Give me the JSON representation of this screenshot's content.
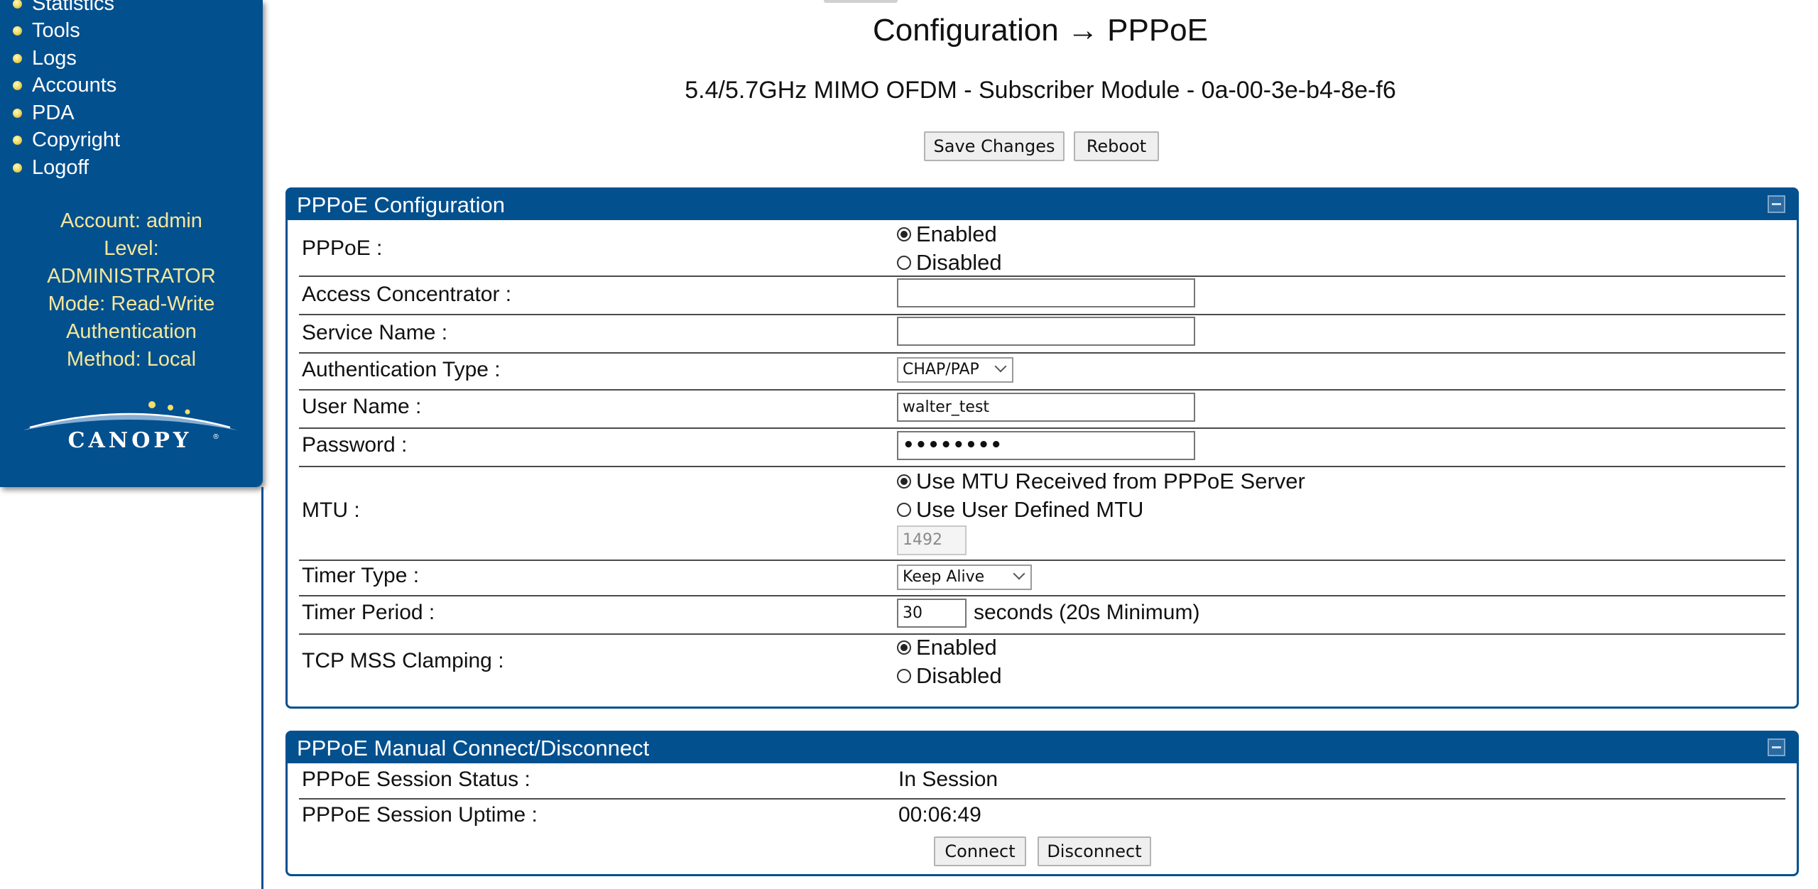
{
  "sidebar": {
    "nav": [
      "Statistics",
      "Tools",
      "Logs",
      "Accounts",
      "PDA",
      "Copyright",
      "Logoff"
    ],
    "account_lines": [
      "Account: admin",
      "Level:",
      "ADMINISTRATOR",
      "Mode: Read-Write",
      "Authentication",
      "Method: Local"
    ],
    "logo_text": "CANOPY",
    "colors": {
      "background": "#03508f",
      "account_text": "#f5e79a",
      "bullet": "#f2e06a"
    }
  },
  "header": {
    "title": "Configuration → PPPoE",
    "device": "5.4/5.7GHz MIMO OFDM - Subscriber Module - 0a-00-3e-b4-8e-f6",
    "save_label": "Save Changes",
    "reboot_label": "Reboot"
  },
  "config": {
    "title": "PPPoE Configuration",
    "pppoe": {
      "label": "PPPoE :",
      "options": [
        "Enabled",
        "Disabled"
      ],
      "selected": "Enabled"
    },
    "access_concentrator": {
      "label": "Access Concentrator :",
      "value": ""
    },
    "service_name": {
      "label": "Service Name :",
      "value": ""
    },
    "auth_type": {
      "label": "Authentication Type :",
      "value": "CHAP/PAP"
    },
    "user_name": {
      "label": "User Name :",
      "value": "walter_test"
    },
    "password": {
      "label": "Password :",
      "value": "••••••••"
    },
    "mtu": {
      "label": "MTU :",
      "options": [
        "Use MTU Received from PPPoE Server",
        "Use User Defined MTU"
      ],
      "selected": "Use MTU Received from PPPoE Server",
      "value": "1492"
    },
    "timer_type": {
      "label": "Timer Type :",
      "value": "Keep Alive"
    },
    "timer_period": {
      "label": "Timer Period :",
      "value": "30",
      "suffix": "seconds (20s Minimum)"
    },
    "tcp_mss": {
      "label": "TCP MSS Clamping :",
      "options": [
        "Enabled",
        "Disabled"
      ],
      "selected": "Enabled"
    }
  },
  "manual": {
    "title": "PPPoE Manual Connect/Disconnect",
    "status_label": "PPPoE Session Status :",
    "status_value": "In Session",
    "uptime_label": "PPPoE Session Uptime :",
    "uptime_value": "00:06:49",
    "connect_label": "Connect",
    "disconnect_label": "Disconnect"
  }
}
